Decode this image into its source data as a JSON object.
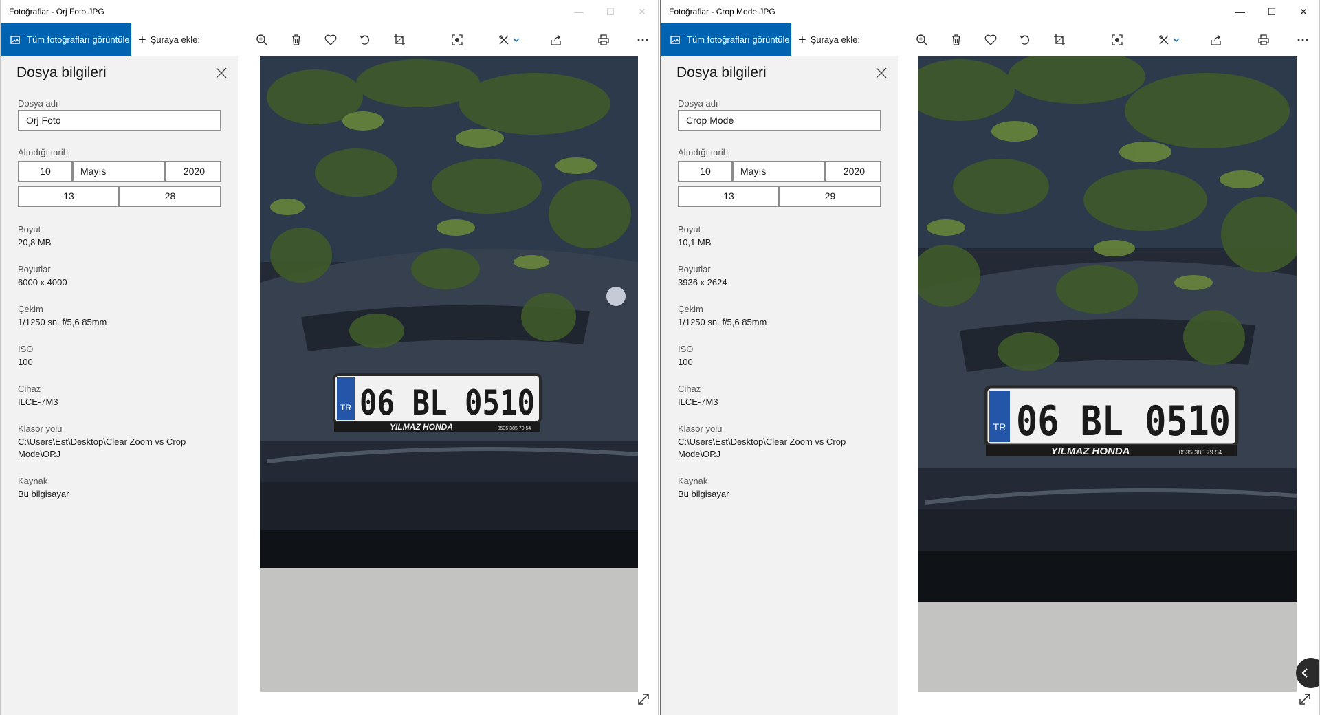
{
  "left": {
    "title": "Fotoğraflar - Orj Foto.JPG",
    "toolbar": {
      "all_photos": "Tüm fotoğrafları görüntüle",
      "add_to": "Şuraya ekle:"
    },
    "panel": {
      "heading": "Dosya bilgileri",
      "file_name_label": "Dosya adı",
      "file_name": "Orj Foto",
      "date_label": "Alındığı tarih",
      "day": "10",
      "month": "Mayıs",
      "year": "2020",
      "hour": "13",
      "minute": "28",
      "size_label": "Boyut",
      "size": "20,8 MB",
      "dimensions_label": "Boyutlar",
      "dimensions": "6000 x 4000",
      "shot_label": "Çekim",
      "shot": "1/1250 sn. f/5,6 85mm",
      "iso_label": "ISO",
      "iso": "100",
      "device_label": "Cihaz",
      "device": "ILCE-7M3",
      "folder_label": "Klasör yolu",
      "folder": "C:\\Users\\Est\\Desktop\\Clear Zoom vs Crop Mode\\ORJ",
      "source_label": "Kaynak",
      "source": "Bu bilgisayar"
    },
    "plate": {
      "number": "06 BL 0510",
      "dealer": "YILMAZ HONDA",
      "country": "TR",
      "phone": "0535 385 79 54"
    }
  },
  "right": {
    "title": "Fotoğraflar - Crop Mode.JPG",
    "toolbar": {
      "all_photos": "Tüm fotoğrafları görüntüle",
      "add_to": "Şuraya ekle:"
    },
    "panel": {
      "heading": "Dosya bilgileri",
      "file_name_label": "Dosya adı",
      "file_name": "Crop Mode",
      "date_label": "Alındığı tarih",
      "day": "10",
      "month": "Mayıs",
      "year": "2020",
      "hour": "13",
      "minute": "29",
      "size_label": "Boyut",
      "size": "10,1 MB",
      "dimensions_label": "Boyutlar",
      "dimensions": "3936 x 2624",
      "shot_label": "Çekim",
      "shot": "1/1250 sn. f/5,6 85mm",
      "iso_label": "ISO",
      "iso": "100",
      "device_label": "Cihaz",
      "device": "ILCE-7M3",
      "folder_label": "Klasör yolu",
      "folder": "C:\\Users\\Est\\Desktop\\Clear Zoom vs Crop Mode\\ORJ",
      "source_label": "Kaynak",
      "source": "Bu bilgisayar"
    },
    "plate": {
      "number": "06 BL 0510",
      "dealer": "YILMAZ HONDA",
      "country": "TR",
      "phone": "0535 385 79 54"
    }
  },
  "icons": {
    "toolbar": [
      "zoom-icon",
      "delete-icon",
      "favorite-icon",
      "rotate-icon",
      "crop-icon",
      "enhance-icon",
      "edit-icon",
      "share-icon",
      "print-icon",
      "more-icon"
    ],
    "window": [
      "minimize-icon",
      "maximize-icon",
      "close-icon"
    ]
  },
  "colors": {
    "accent": "#0063b1",
    "panel": "#f2f2f2",
    "titlebar": "#ffffff"
  }
}
